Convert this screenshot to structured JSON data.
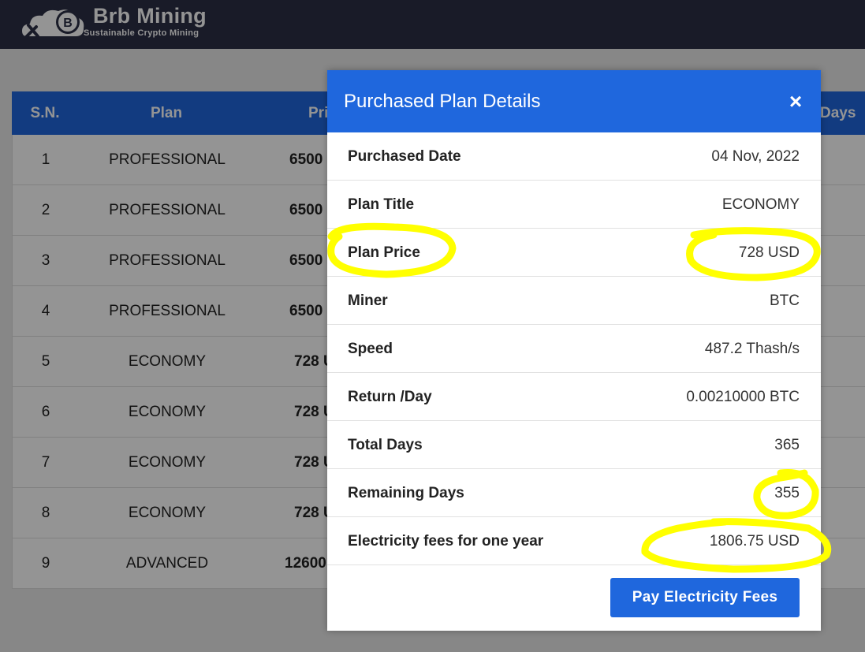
{
  "header": {
    "brand": "Brb Mining",
    "tagline": "Sustainable Crypto Mining"
  },
  "table": {
    "columns": [
      "S.N.",
      "Plan",
      "Pri",
      "Days"
    ],
    "rows": [
      {
        "sn": "1",
        "plan": "PROFESSIONAL",
        "price": "6500"
      },
      {
        "sn": "2",
        "plan": "PROFESSIONAL",
        "price": "6500"
      },
      {
        "sn": "3",
        "plan": "PROFESSIONAL",
        "price": "6500"
      },
      {
        "sn": "4",
        "plan": "PROFESSIONAL",
        "price": "6500"
      },
      {
        "sn": "5",
        "plan": "ECONOMY",
        "price": "728 U"
      },
      {
        "sn": "6",
        "plan": "ECONOMY",
        "price": "728 U"
      },
      {
        "sn": "7",
        "plan": "ECONOMY",
        "price": "728 U"
      },
      {
        "sn": "8",
        "plan": "ECONOMY",
        "price": "728 U"
      },
      {
        "sn": "9",
        "plan": "ADVANCED",
        "price": "12600"
      }
    ]
  },
  "modal": {
    "title": "Purchased Plan Details",
    "close_label": "×",
    "details": [
      {
        "label": "Purchased Date",
        "value": "04 Nov, 2022"
      },
      {
        "label": "Plan Title",
        "value": "ECONOMY"
      },
      {
        "label": "Plan Price",
        "value": "728 USD"
      },
      {
        "label": "Miner",
        "value": "BTC"
      },
      {
        "label": "Speed",
        "value": "487.2 Thash/s"
      },
      {
        "label": "Return /Day",
        "value": "0.00210000 BTC"
      },
      {
        "label": "Total Days",
        "value": "365"
      },
      {
        "label": "Remaining Days",
        "value": "355"
      },
      {
        "label": "Electricity fees for one year",
        "value": "1806.75 USD"
      }
    ],
    "pay_button": "Pay Electricity Fees"
  },
  "colors": {
    "header_bg": "#2b2f46",
    "accent": "#1f67dd",
    "highlight": "#ffff00"
  }
}
